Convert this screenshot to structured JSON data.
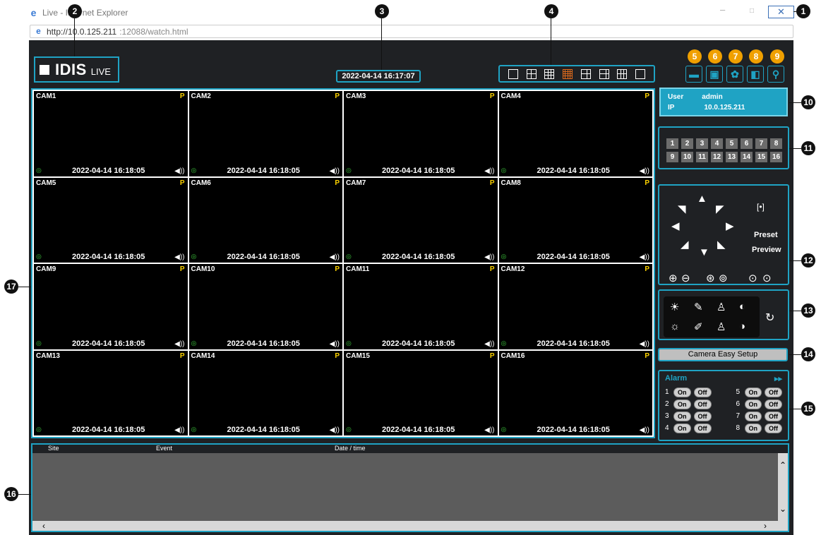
{
  "window": {
    "title": "Live - Internet Explorer",
    "url_host": "http://10.0.125.211",
    "url_path": ":12088/watch.html",
    "min_glyph": "–",
    "max_glyph": "□",
    "close_glyph": "✕"
  },
  "app": {
    "logo_text": "IDIS",
    "logo_sub": "LIVE",
    "clock": "2022-04-14 16:17:07"
  },
  "user_info": {
    "user_label": "User",
    "user_value": "admin",
    "ip_label": "IP",
    "ip_value": "10.0.125.211"
  },
  "cameras": [
    {
      "name": "CAM1",
      "time": "2022-04-14 16:18:05"
    },
    {
      "name": "CAM2",
      "time": "2022-04-14 16:18:05"
    },
    {
      "name": "CAM3",
      "time": "2022-04-14 16:18:05"
    },
    {
      "name": "CAM4",
      "time": "2022-04-14 16:18:05"
    },
    {
      "name": "CAM5",
      "time": "2022-04-14 16:18:05"
    },
    {
      "name": "CAM6",
      "time": "2022-04-14 16:18:05"
    },
    {
      "name": "CAM7",
      "time": "2022-04-14 16:18:05"
    },
    {
      "name": "CAM8",
      "time": "2022-04-14 16:18:05"
    },
    {
      "name": "CAM9",
      "time": "2022-04-14 16:18:05"
    },
    {
      "name": "CAM10",
      "time": "2022-04-14 16:18:05"
    },
    {
      "name": "CAM11",
      "time": "2022-04-14 16:18:05"
    },
    {
      "name": "CAM12",
      "time": "2022-04-14 16:18:05"
    },
    {
      "name": "CAM13",
      "time": "2022-04-14 16:18:05"
    },
    {
      "name": "CAM14",
      "time": "2022-04-14 16:18:05"
    },
    {
      "name": "CAM15",
      "time": "2022-04-14 16:18:05"
    },
    {
      "name": "CAM16",
      "time": "2022-04-14 16:18:05"
    }
  ],
  "camera_badge": "P",
  "camera_numbers": [
    "1",
    "2",
    "3",
    "4",
    "5",
    "6",
    "7",
    "8",
    "9",
    "10",
    "11",
    "12",
    "13",
    "14",
    "15",
    "16"
  ],
  "ptz": {
    "preset": "Preset",
    "preview": "Preview"
  },
  "easy_setup": "Camera Easy Setup",
  "alarm": {
    "title": "Alarm",
    "on": "On",
    "off": "Off",
    "items": [
      "1",
      "2",
      "3",
      "4",
      "5",
      "6",
      "7",
      "8"
    ]
  },
  "events": {
    "col_site": "Site",
    "col_event": "Event",
    "col_datetime": "Date / time"
  },
  "callouts": [
    "1",
    "2",
    "3",
    "4",
    "5",
    "6",
    "7",
    "8",
    "9",
    "10",
    "11",
    "12",
    "13",
    "14",
    "15",
    "16",
    "17"
  ],
  "colors": {
    "accent": "#1fa3c4",
    "selected_layout": "#e06b1b",
    "callout": "#f0a000"
  }
}
